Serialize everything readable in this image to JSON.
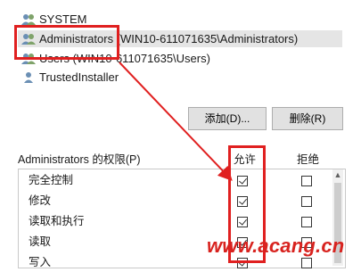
{
  "users": [
    {
      "label": "SYSTEM",
      "icon": "users-icon"
    },
    {
      "label": "Administrators (WIN10-611071635\\Administrators)",
      "icon": "users-icon",
      "selected": true
    },
    {
      "label": "Users (WIN10-611071635\\Users)",
      "icon": "users-icon"
    },
    {
      "label": "TrustedInstaller",
      "icon": "user-icon"
    }
  ],
  "buttons": {
    "add": "添加(D)...",
    "remove": "删除(R)"
  },
  "permissions": {
    "header_label": "Administrators 的权限(P)",
    "allow_header": "允许",
    "deny_header": "拒绝",
    "rows": [
      {
        "label": "完全控制",
        "allow": true,
        "deny": false
      },
      {
        "label": "修改",
        "allow": true,
        "deny": false
      },
      {
        "label": "读取和执行",
        "allow": true,
        "deny": false
      },
      {
        "label": "读取",
        "allow": true,
        "deny": false
      },
      {
        "label": "写入",
        "allow": true,
        "deny": false
      }
    ]
  },
  "watermark": "www.acang.cn",
  "colors": {
    "annotation": "#e02020",
    "selection": "#e5e5e5"
  }
}
